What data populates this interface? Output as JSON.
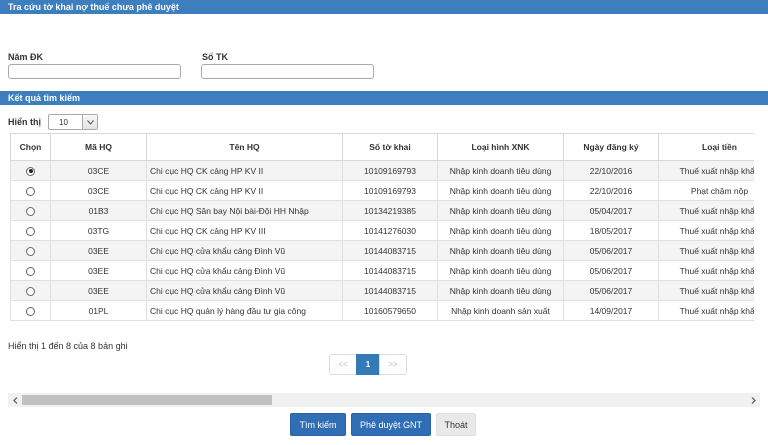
{
  "search_panel": {
    "title": "Tra cứu tờ khai nợ thuế chưa phê duyệt"
  },
  "fields": {
    "nam_dk": {
      "label": "Năm ĐK",
      "value": ""
    },
    "so_tk": {
      "label": "Số TK",
      "value": ""
    }
  },
  "results_panel": {
    "title": "Kết quả tìm kiếm"
  },
  "page_size": {
    "label": "Hiển thị",
    "value": "10"
  },
  "table": {
    "headers": [
      "Chọn",
      "Mã HQ",
      "Tên HQ",
      "Số tờ khai",
      "Loại hình XNK",
      "Ngày đăng ký",
      "Loại tiền"
    ],
    "rows": [
      {
        "selected": true,
        "ma_hq": "03CE",
        "ten_hq": "Chi cục HQ CK cảng HP KV II",
        "so_to_khai": "10109169793",
        "loai_hinh": "Nhập kinh doanh tiêu dùng",
        "ngay_dk": "22/10/2016",
        "loai_tien": "Thuế xuất nhập khẩu"
      },
      {
        "selected": false,
        "ma_hq": "03CE",
        "ten_hq": "Chi cục HQ CK cảng HP KV II",
        "so_to_khai": "10109169793",
        "loai_hinh": "Nhập kinh doanh tiêu dùng",
        "ngay_dk": "22/10/2016",
        "loai_tien": "Phạt chậm nộp"
      },
      {
        "selected": false,
        "ma_hq": "01B3",
        "ten_hq": "Chi cục HQ Sân bay Nội bài-Đội HH Nhập",
        "so_to_khai": "10134219385",
        "loai_hinh": "Nhập kinh doanh tiêu dùng",
        "ngay_dk": "05/04/2017",
        "loai_tien": "Thuế xuất nhập khẩu"
      },
      {
        "selected": false,
        "ma_hq": "03TG",
        "ten_hq": "Chi cục HQ CK cảng HP KV III",
        "so_to_khai": "10141276030",
        "loai_hinh": "Nhập kinh doanh tiêu dùng",
        "ngay_dk": "18/05/2017",
        "loai_tien": "Thuế xuất nhập khẩu"
      },
      {
        "selected": false,
        "ma_hq": "03EE",
        "ten_hq": "Chi cục HQ cửa khẩu cảng Đình Vũ",
        "so_to_khai": "10144083715",
        "loai_hinh": "Nhập kinh doanh tiêu dùng",
        "ngay_dk": "05/06/2017",
        "loai_tien": "Thuế xuất nhập khẩu"
      },
      {
        "selected": false,
        "ma_hq": "03EE",
        "ten_hq": "Chi cục HQ cửa khẩu cảng Đình Vũ",
        "so_to_khai": "10144083715",
        "loai_hinh": "Nhập kinh doanh tiêu dùng",
        "ngay_dk": "05/06/2017",
        "loai_tien": "Thuế xuất nhập khẩu"
      },
      {
        "selected": false,
        "ma_hq": "03EE",
        "ten_hq": "Chi cục HQ cửa khẩu cảng Đình Vũ",
        "so_to_khai": "10144083715",
        "loai_hinh": "Nhập kinh doanh tiêu dùng",
        "ngay_dk": "05/06/2017",
        "loai_tien": "Thuế xuất nhập khẩu"
      },
      {
        "selected": false,
        "ma_hq": "01PL",
        "ten_hq": "Chi cục HQ quản lý hàng đầu tư gia công",
        "so_to_khai": "10160579650",
        "loai_hinh": "Nhập kinh doanh sản xuất",
        "ngay_dk": "14/09/2017",
        "loai_tien": "Thuế xuất nhập khẩu"
      }
    ]
  },
  "info_text": "Hiển thị 1 đến 8 của 8 bản ghi",
  "pagination": {
    "prev": "<<",
    "current": "1",
    "next": ">>"
  },
  "scrollbar": {
    "left_icon": "left-arrow-icon",
    "right_icon": "right-arrow-icon"
  },
  "buttons": {
    "search": "Tìm kiếm",
    "approve": "Phê duyệt GNT",
    "exit": "Thoát"
  },
  "colors": {
    "header_blue": "#3d7ebf",
    "button_blue": "#2f6db5",
    "page_active": "#337ab7"
  }
}
